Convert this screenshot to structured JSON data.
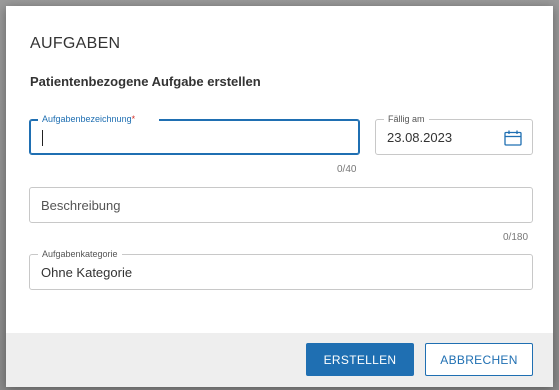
{
  "dialog": {
    "title": "AUFGABEN",
    "subtitle": "Patientenbezogene Aufgabe erstellen"
  },
  "fields": {
    "task_name": {
      "label": "Aufgabenbezeichnung",
      "required_marker": "*",
      "value": "",
      "counter": "0/40"
    },
    "due_date": {
      "label": "Fällig am",
      "value": "23.08.2023"
    },
    "description": {
      "placeholder": "Beschreibung",
      "value": "",
      "counter": "0/180"
    },
    "category": {
      "label": "Aufgabenkategorie",
      "value": "Ohne Kategorie"
    }
  },
  "icons": {
    "due_date_picker": "calendar-icon"
  },
  "footer": {
    "create_label": "ERSTELLEN",
    "cancel_label": "ABBRECHEN"
  },
  "colors": {
    "accent": "#1f6fb2",
    "required": "#d0302a",
    "footer_bg": "#eeeeee"
  }
}
